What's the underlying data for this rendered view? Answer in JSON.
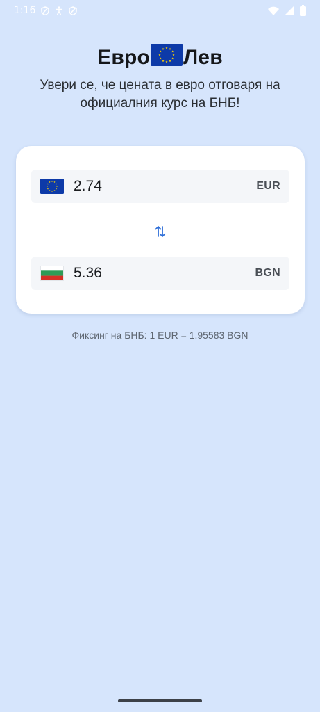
{
  "status_bar": {
    "time": "1:16",
    "icons": [
      "vpn-shield-icon",
      "accessibility-icon",
      "vpn-shield-icon",
      "wifi-icon",
      "cellular-signal-icon",
      "battery-icon"
    ]
  },
  "header": {
    "logo_left": "Евро",
    "logo_right": "Лев",
    "subtitle": "Увери се, че цената в евро отговаря на официалния курс на БНБ!"
  },
  "converter": {
    "eur": {
      "amount": "2.74",
      "code": "EUR",
      "flag": "eu-flag-icon"
    },
    "bgn": {
      "amount": "5.36",
      "code": "BGN",
      "flag": "bulgaria-flag-icon"
    },
    "swap_icon": "swap-arrows-icon"
  },
  "fixing_text": "Фиксинг на БНБ: 1 EUR = 1.95583 BGN",
  "colors": {
    "background": "#d6e5fc",
    "card": "#ffffff",
    "accent": "#2f6fd8",
    "eu_blue": "#0d3aa8",
    "eu_star": "#ffd200",
    "bg_white": "#ffffff",
    "bg_green": "#2e9b57",
    "bg_red": "#d62f26"
  }
}
